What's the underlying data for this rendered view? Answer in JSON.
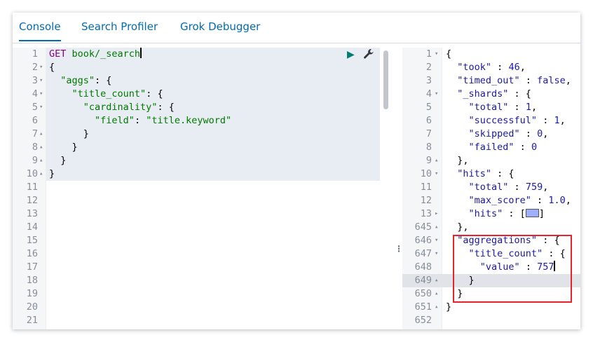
{
  "tabs": [
    {
      "label": "Console"
    },
    {
      "label": "Search Profiler"
    },
    {
      "label": "Grok Debugger"
    }
  ],
  "request": {
    "lines": [
      {
        "num": "1",
        "fold": "",
        "html": "<span class='k'>GET</span> <span class='s'>book/_search</span>"
      },
      {
        "num": "2",
        "fold": "▾",
        "html": "{"
      },
      {
        "num": "3",
        "fold": "▾",
        "html": "  <span class='s'>\"aggs\"</span>: {"
      },
      {
        "num": "4",
        "fold": "▾",
        "html": "    <span class='s'>\"title_count\"</span>: {"
      },
      {
        "num": "5",
        "fold": "▾",
        "html": "      <span class='s'>\"cardinality\"</span>: {"
      },
      {
        "num": "6",
        "fold": "",
        "html": "        <span class='s'>\"field\"</span>: <span class='s'>\"title.keyword\"</span>"
      },
      {
        "num": "7",
        "fold": "▴",
        "html": "      }"
      },
      {
        "num": "8",
        "fold": "▴",
        "html": "    }"
      },
      {
        "num": "9",
        "fold": "▴",
        "html": "  }"
      },
      {
        "num": "10",
        "fold": "▴",
        "html": "}"
      },
      {
        "num": "11",
        "fold": "",
        "html": ""
      },
      {
        "num": "12",
        "fold": "",
        "html": ""
      },
      {
        "num": "13",
        "fold": "",
        "html": ""
      },
      {
        "num": "14",
        "fold": "",
        "html": ""
      },
      {
        "num": "15",
        "fold": "",
        "html": ""
      },
      {
        "num": "16",
        "fold": "",
        "html": ""
      },
      {
        "num": "17",
        "fold": "",
        "html": ""
      },
      {
        "num": "18",
        "fold": "",
        "html": ""
      },
      {
        "num": "19",
        "fold": "",
        "html": ""
      },
      {
        "num": "20",
        "fold": "",
        "html": ""
      },
      {
        "num": "21",
        "fold": "",
        "html": ""
      }
    ]
  },
  "response": {
    "lines": [
      {
        "num": "1",
        "fold": "▾",
        "html": "{"
      },
      {
        "num": "2",
        "fold": "",
        "html": "  <span class='key'>\"took\"</span> : <span class='n'>46</span>,"
      },
      {
        "num": "3",
        "fold": "",
        "html": "  <span class='key'>\"timed_out\"</span> : <span class='b'>false</span>,"
      },
      {
        "num": "4",
        "fold": "▾",
        "html": "  <span class='key'>\"_shards\"</span> : {"
      },
      {
        "num": "5",
        "fold": "",
        "html": "    <span class='key'>\"total\"</span> : <span class='n'>1</span>,"
      },
      {
        "num": "6",
        "fold": "",
        "html": "    <span class='key'>\"successful\"</span> : <span class='n'>1</span>,"
      },
      {
        "num": "7",
        "fold": "",
        "html": "    <span class='key'>\"skipped\"</span> : <span class='n'>0</span>,"
      },
      {
        "num": "8",
        "fold": "",
        "html": "    <span class='key'>\"failed\"</span> : <span class='n'>0</span>"
      },
      {
        "num": "9",
        "fold": "▴",
        "html": "  },"
      },
      {
        "num": "10",
        "fold": "▾",
        "html": "  <span class='key'>\"hits\"</span> : {"
      },
      {
        "num": "11",
        "fold": "",
        "html": "    <span class='key'>\"total\"</span> : <span class='n'>759</span>,"
      },
      {
        "num": "12",
        "fold": "",
        "html": "    <span class='key'>\"max_score\"</span> : <span class='n'>1.0</span>,"
      },
      {
        "num": "13",
        "fold": "▸",
        "html": "    <span class='key'>\"hits\"</span> : [<span style='display:inline-block;width:17px;height:10px;background:#9fb0ff;border:1px solid #555;vertical-align:-1px;'></span>]"
      },
      {
        "num": "645",
        "fold": "▴",
        "html": "  },"
      },
      {
        "num": "646",
        "fold": "▾",
        "html": "  <span class='key'>\"aggregations\"</span> : {"
      },
      {
        "num": "647",
        "fold": "▾",
        "html": "    <span class='key'>\"title_count\"</span> : {"
      },
      {
        "num": "648",
        "fold": "",
        "html": "      <span class='key'>\"value\"</span> : <span class='n'>757</span>"
      },
      {
        "num": "649",
        "fold": "▴",
        "html": "    }"
      },
      {
        "num": "650",
        "fold": "▴",
        "html": "  }"
      },
      {
        "num": "651",
        "fold": "▴",
        "html": "}"
      },
      {
        "num": "652",
        "fold": "",
        "html": ""
      }
    ]
  },
  "icons": {
    "run": "play-icon",
    "settings": "wrench-icon",
    "resize": "drag-handle-icon"
  },
  "colors": {
    "accent": "#006bb4",
    "highlight": "#e8212a"
  }
}
